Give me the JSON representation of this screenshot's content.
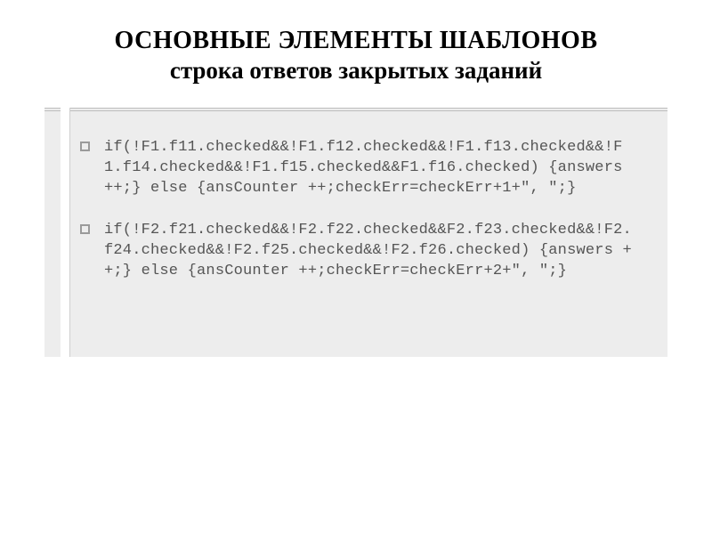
{
  "title": {
    "line1": "ОСНОВНЫЕ ЭЛЕМЕНТЫ ШАБЛОНОВ",
    "line2": "строка ответов закрытых заданий"
  },
  "bullets": [
    {
      "text": "if(!F1.f11.checked&&!F1.f12.checked&&!F1.f13.checked&&!F1.f14.checked&&!F1.f15.checked&&F1.f16.checked) {answers ++;} else {ansCounter ++;checkErr=checkErr+1+\", \";}"
    },
    {
      "text": "if(!F2.f21.checked&&!F2.f22.checked&&F2.f23.checked&&!F2.f24.checked&&!F2.f25.checked&&!F2.f26.checked) {answers ++;} else {ansCounter ++;checkErr=checkErr+2+\", \";}"
    }
  ]
}
